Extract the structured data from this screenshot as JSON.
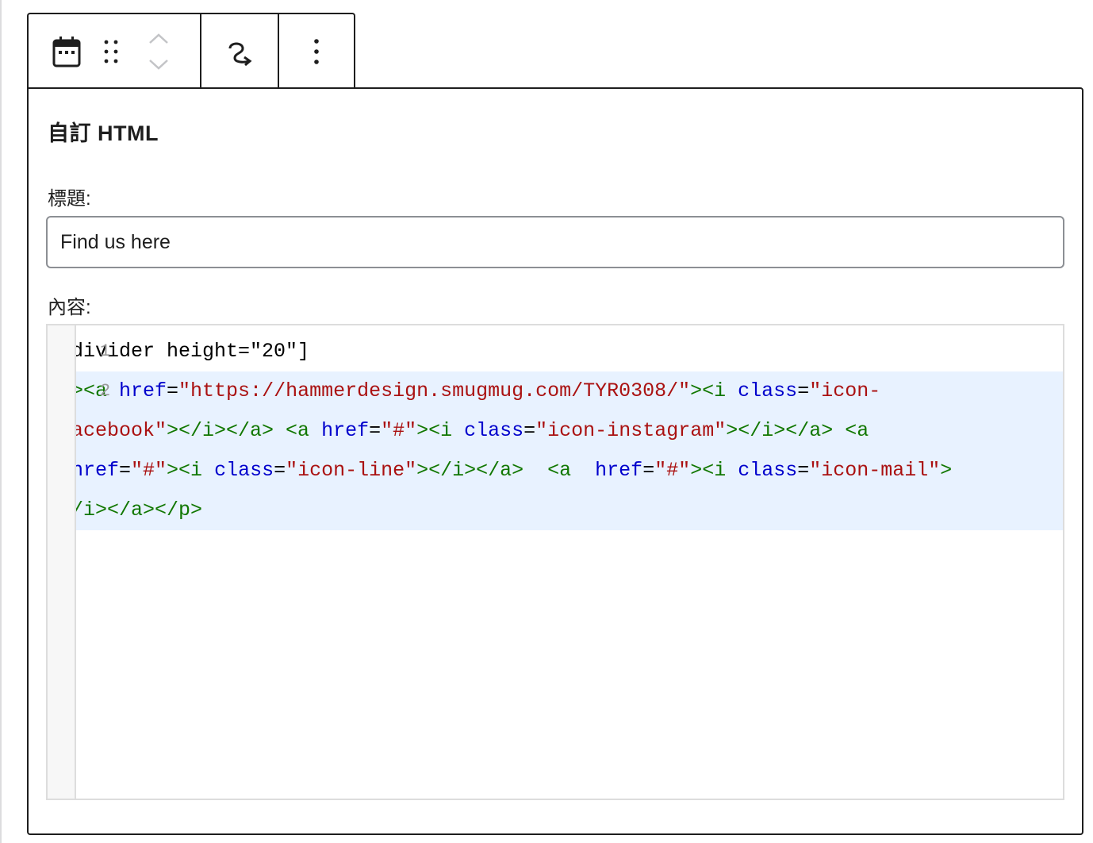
{
  "toolbar": {
    "block_icon": "calendar-icon",
    "drag_icon": "drag-handle-icon",
    "move_up_icon": "chevron-up-icon",
    "move_down_icon": "chevron-down-icon",
    "transform_icon": "transform-loop-icon",
    "more_icon": "more-vertical-icon"
  },
  "panel": {
    "title": "自訂 HTML",
    "title_label": "標題:",
    "title_value": "Find us here",
    "content_label": "內容:"
  },
  "editor": {
    "line_numbers": [
      "1",
      "2"
    ],
    "line1": "divider height=\"20\"]",
    "line2_rows": [
      [
        {
          "t": "tag",
          "v": "><a "
        },
        {
          "t": "attr",
          "v": "href"
        },
        {
          "t": "plain",
          "v": "="
        },
        {
          "t": "str",
          "v": "\"https://hammerdesign.smugmug.com/TYR0308/\""
        },
        {
          "t": "tag",
          "v": "><i "
        },
        {
          "t": "attr",
          "v": "class"
        },
        {
          "t": "plain",
          "v": "="
        },
        {
          "t": "str",
          "v": "\"icon-"
        }
      ],
      [
        {
          "t": "str",
          "v": "acebook\""
        },
        {
          "t": "tag",
          "v": "></i></a> <a "
        },
        {
          "t": "attr",
          "v": "href"
        },
        {
          "t": "plain",
          "v": "="
        },
        {
          "t": "str",
          "v": "\"#\""
        },
        {
          "t": "tag",
          "v": "><i "
        },
        {
          "t": "attr",
          "v": "class"
        },
        {
          "t": "plain",
          "v": "="
        },
        {
          "t": "str",
          "v": "\"icon-instagram\""
        },
        {
          "t": "tag",
          "v": "></i></a> <a"
        }
      ],
      [
        {
          "t": "attr",
          "v": "href"
        },
        {
          "t": "plain",
          "v": "="
        },
        {
          "t": "str",
          "v": "\"#\""
        },
        {
          "t": "tag",
          "v": "><i "
        },
        {
          "t": "attr",
          "v": "class"
        },
        {
          "t": "plain",
          "v": "="
        },
        {
          "t": "str",
          "v": "\"icon-line\""
        },
        {
          "t": "tag",
          "v": "></i></a>  <a  "
        },
        {
          "t": "attr",
          "v": "href"
        },
        {
          "t": "plain",
          "v": "="
        },
        {
          "t": "str",
          "v": "\"#\""
        },
        {
          "t": "tag",
          "v": "><i "
        },
        {
          "t": "attr",
          "v": "class"
        },
        {
          "t": "plain",
          "v": "="
        },
        {
          "t": "str",
          "v": "\"icon-mail\""
        },
        {
          "t": "tag",
          "v": ">"
        }
      ],
      [
        {
          "t": "tag",
          "v": "/i></a></p>"
        }
      ]
    ]
  }
}
